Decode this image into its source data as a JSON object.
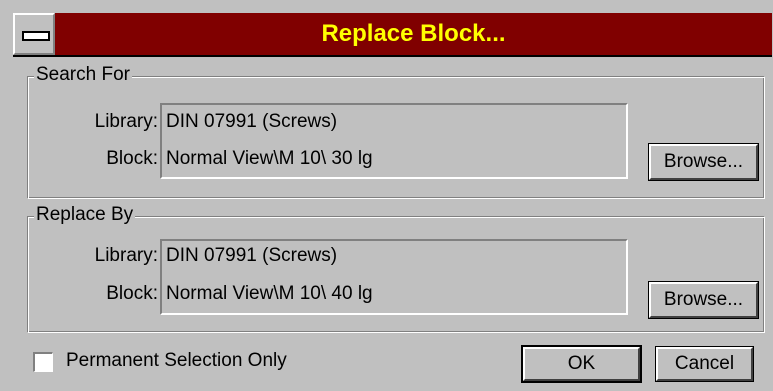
{
  "window": {
    "title": "Replace Block..."
  },
  "search_for": {
    "legend": "Search For",
    "library_label": "Library:",
    "library_value": "DIN 07991 (Screws)",
    "block_label": "Block:",
    "block_value": "Normal View\\M 10\\ 30 lg",
    "browse_label": "Browse..."
  },
  "replace_by": {
    "legend": "Replace By",
    "library_label": "Library:",
    "library_value": "DIN 07991 (Screws)",
    "block_label": "Block:",
    "block_value": "Normal View\\M 10\\ 40 lg",
    "browse_label": "Browse..."
  },
  "options": {
    "permanent_selection_only": "Permanent Selection Only",
    "checked": false
  },
  "buttons": {
    "ok": "OK",
    "cancel": "Cancel"
  },
  "colors": {
    "title_bar": "#800000",
    "title_text": "#ffff00",
    "face": "#c0c0c0"
  }
}
